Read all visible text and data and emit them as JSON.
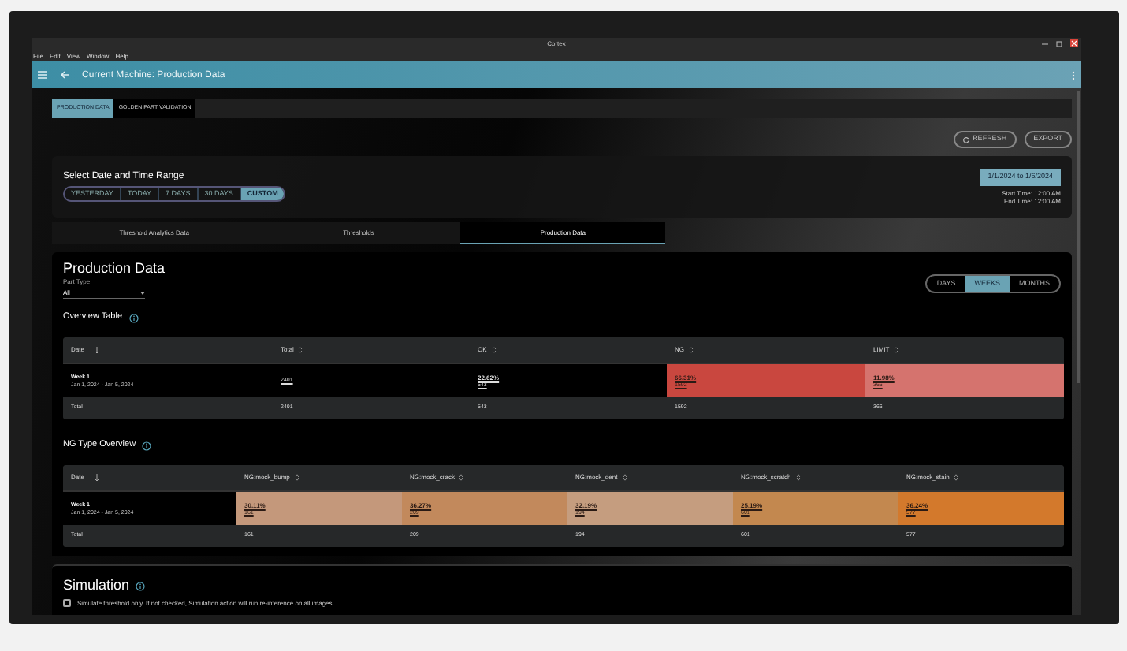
{
  "window": {
    "title": "Cortex"
  },
  "menu": [
    "File",
    "Edit",
    "View",
    "Window",
    "Help"
  ],
  "app_bar": {
    "title": "Current Machine: Production Data"
  },
  "view_tabs": [
    {
      "label": "PRODUCTION DATA",
      "selected": true
    },
    {
      "label": "GOLDEN PART VALIDATION",
      "selected": false
    }
  ],
  "actions": [
    {
      "label": "REFRESH",
      "kind": "refresh"
    },
    {
      "label": "EXPORT",
      "kind": "plain"
    }
  ],
  "date_range": {
    "title": "Select Date and Time Range",
    "presets": [
      {
        "label": "YESTERDAY",
        "selected": false
      },
      {
        "label": "TODAY",
        "selected": false
      },
      {
        "label": "7 DAYS",
        "selected": false
      },
      {
        "label": "30 DAYS",
        "selected": false
      },
      {
        "label": "CUSTOM",
        "selected": true
      }
    ],
    "range": "1/1/2024 to 1/6/2024",
    "start": "Start Time: 12:00 AM",
    "end": "End Time: 12:00 AM"
  },
  "data_tabs": [
    {
      "label": "Threshold Analytics Data",
      "selected": false
    },
    {
      "label": "Thresholds",
      "selected": false
    },
    {
      "label": "Production Data",
      "selected": true
    }
  ],
  "production": {
    "title": "Production Data",
    "part_type_label": "Part Type",
    "part_type": "All",
    "periods": [
      {
        "label": "DAYS",
        "selected": false
      },
      {
        "label": "WEEKS",
        "selected": true
      },
      {
        "label": "MONTHS",
        "selected": false
      }
    ]
  },
  "tables": [
    {
      "title": "Overview Table",
      "columns": [
        {
          "label": "Date",
          "sorted": true
        },
        {
          "label": "Total",
          "sorted": false
        },
        {
          "label": "OK",
          "sorted": false
        },
        {
          "label": "NG",
          "sorted": false
        },
        {
          "label": "LIMIT",
          "sorted": false
        }
      ],
      "rows": [
        [
          {
            "kind": "date",
            "title": "Week 1",
            "subtitle": "Jan 1, 2024 - Jan 5, 2024"
          },
          {
            "kind": "count",
            "value": "2401"
          },
          {
            "kind": "share",
            "percent": "22.62%",
            "count": "543"
          },
          {
            "kind": "share",
            "percent": "66.31%",
            "count": "1592",
            "color": "#c9473f"
          },
          {
            "kind": "share",
            "percent": "11.98%",
            "count": "366",
            "color": "#d5736e"
          }
        ]
      ],
      "total": [
        "Total",
        "2401",
        "543",
        "1592",
        "366"
      ]
    },
    {
      "title": "NG Type Overview",
      "columns": [
        {
          "label": "Date",
          "sorted": true
        },
        {
          "label": "NG:mock_bump",
          "sorted": false
        },
        {
          "label": "NG:mock_crack",
          "sorted": false
        },
        {
          "label": "NG:mock_dent",
          "sorted": false
        },
        {
          "label": "NG:mock_scratch",
          "sorted": false
        },
        {
          "label": "NG:mock_stain",
          "sorted": false
        }
      ],
      "rows": [
        [
          {
            "kind": "date",
            "title": "Week 1",
            "subtitle": "Jan 1, 2024 - Jan 5, 2024"
          },
          {
            "kind": "share",
            "percent": "30.11%",
            "count": "161",
            "color": "#c4987b"
          },
          {
            "kind": "share",
            "percent": "36.27%",
            "count": "209",
            "color": "#c2895c"
          },
          {
            "kind": "share",
            "percent": "32.19%",
            "count": "194",
            "color": "#c59d7f"
          },
          {
            "kind": "share",
            "percent": "25.19%",
            "count": "601",
            "color": "#c3884f"
          },
          {
            "kind": "share",
            "percent": "36.24%",
            "count": "577",
            "color": "#d3792c"
          }
        ]
      ],
      "total": [
        "Total",
        "161",
        "209",
        "194",
        "601",
        "577"
      ]
    }
  ],
  "simulation": {
    "title": "Simulation",
    "checked": false,
    "label": "Simulate threshold only. If not checked, Simulation action will run re-inference on all images."
  }
}
